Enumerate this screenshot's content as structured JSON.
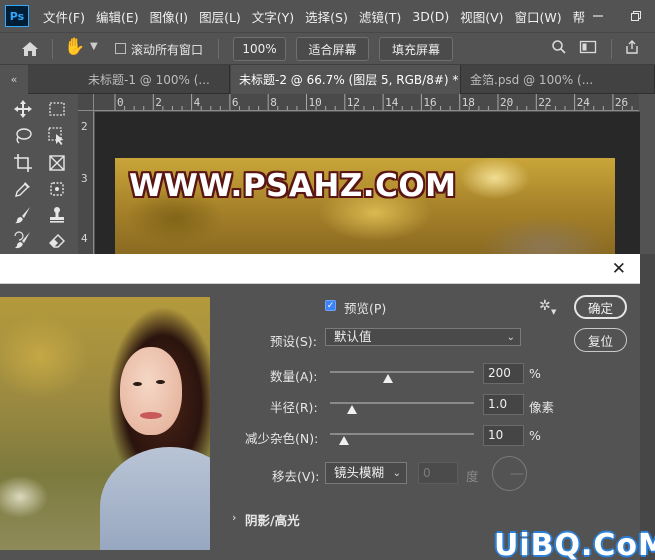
{
  "app": {
    "logo": "Ps"
  },
  "menubar": {
    "items": [
      "文件(F)",
      "编辑(E)",
      "图像(I)",
      "图层(L)",
      "文字(Y)",
      "选择(S)",
      "滤镜(T)",
      "3D(D)",
      "视图(V)",
      "窗口(W)",
      "帮"
    ]
  },
  "options_bar": {
    "scroll_all_label": "滚动所有窗口",
    "zoom_label": "100%",
    "fit_screen_label": "适合屏幕",
    "fill_screen_label": "填充屏幕"
  },
  "tabs": [
    {
      "label": "未标题-1 @ 100% (...",
      "active": false
    },
    {
      "label": "未标题-2 @ 66.7% (图层 5, RGB/8#) *",
      "active": true
    },
    {
      "label": "金箔.psd @ 100% (...",
      "active": false
    }
  ],
  "ruler": {
    "h_labels": [
      "0",
      "2",
      "4",
      "6",
      "8",
      "10",
      "12",
      "14",
      "16",
      "18",
      "20",
      "22",
      "24",
      "26"
    ],
    "v_labels": [
      "2",
      "3",
      "4"
    ]
  },
  "canvas": {
    "watermark_text": "WWW.PSAHZ.COM"
  },
  "dialog": {
    "preview_label": "预览(P)",
    "preview_checked": true,
    "ok_label": "确定",
    "reset_label": "复位",
    "preset_label": "预设(S):",
    "preset_value": "默认值",
    "amount_label": "数量(A):",
    "amount_value": "200",
    "amount_unit": "%",
    "amount_fraction": 0.4,
    "radius_label": "半径(R):",
    "radius_value": "1.0",
    "radius_unit": "像素",
    "radius_fraction": 0.15,
    "noise_label": "减少杂色(N):",
    "noise_value": "10",
    "noise_unit": "%",
    "noise_fraction": 0.1,
    "remove_label": "移去(V):",
    "remove_value": "镜头模糊",
    "angle_value": "0",
    "angle_unit": "度",
    "shadow_section_label": "阴影/高光"
  },
  "site_watermark": "UiBQ.CoM",
  "colors": {
    "checkbox": "#3b82f6",
    "panel": "#535353",
    "canvas_bg": "#282828"
  }
}
